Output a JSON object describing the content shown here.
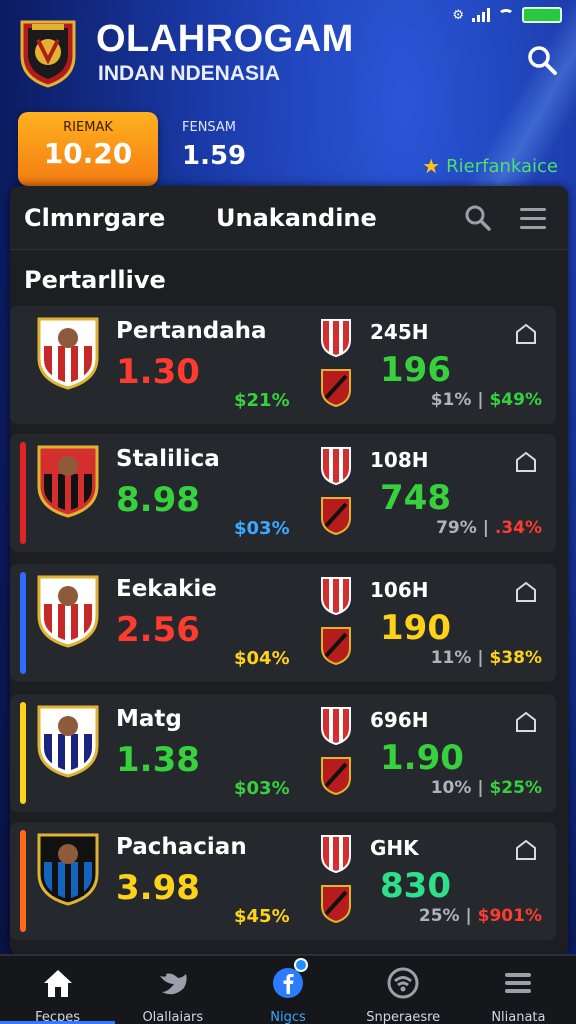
{
  "app": {
    "title": "OLAHROGAM",
    "subtitle": "INDAN NDENASIA"
  },
  "stats": {
    "primary": {
      "label": "RIEMAK",
      "value": "10.20"
    },
    "secondary": {
      "label": "FENSAM",
      "value": "1.59"
    },
    "featured_label": "Rierfankaice"
  },
  "tabs": [
    {
      "label": "Clmnrgare"
    },
    {
      "label": "Unakandine"
    }
  ],
  "section_title": "Pertarllive",
  "matches": [
    {
      "name": "Pertandaha",
      "odds": "1.30",
      "odds_color": "#ff3b30",
      "pct": "$21%",
      "pct_color": "#36d13c",
      "stripe": "#25282d",
      "volume": "245H",
      "odds2": "196",
      "odds2_color": "#36d13c",
      "pct2_a": "$1%",
      "pct2_b": "$49%",
      "pct2_b_color": "#36d13c"
    },
    {
      "name": "Stalilica",
      "odds": "8.98",
      "odds_color": "#36d13c",
      "pct": "$03%",
      "pct_color": "#3aa9ff",
      "stripe": "#e02424",
      "volume": "108H",
      "odds2": "748",
      "odds2_color": "#36d13c",
      "pct2_a": "79%",
      "pct2_b": ".34%",
      "pct2_b_color": "#ff3b30"
    },
    {
      "name": "Eekakie",
      "odds": "2.56",
      "odds_color": "#ff3b30",
      "pct": "$04%",
      "pct_color": "#ffd21a",
      "stripe": "#2f6bff",
      "volume": "106H",
      "odds2": "190",
      "odds2_color": "#ffd21a",
      "pct2_a": "11%",
      "pct2_b": "$38%",
      "pct2_b_color": "#ffd21a"
    },
    {
      "name": "Matg",
      "odds": "1.38",
      "odds_color": "#36d13c",
      "pct": "$03%",
      "pct_color": "#36d13c",
      "stripe": "#ffd21a",
      "volume": "696H",
      "odds2": "1.90",
      "odds2_color": "#36d13c",
      "pct2_a": "10%",
      "pct2_b": "$25%",
      "pct2_b_color": "#36d13c"
    },
    {
      "name": "Pachacian",
      "odds": "3.98",
      "odds_color": "#ffd21a",
      "pct": "$45%",
      "pct_color": "#ffd21a",
      "stripe": "#ff6a1a",
      "volume": " GHK",
      "odds2": "830",
      "odds2_color": "#2ee08a",
      "pct2_a": "25%",
      "pct2_b": "$901%",
      "pct2_b_color": "#ff3b30"
    }
  ],
  "nav": [
    {
      "label": "Fecpes",
      "icon": "home-icon"
    },
    {
      "label": "Olallaiars",
      "icon": "bird-icon"
    },
    {
      "label": "Nigcs",
      "icon": "facebook-icon"
    },
    {
      "label": "Snperaesre",
      "icon": "signal-icon"
    },
    {
      "label": "Nlianata",
      "icon": "menu-icon"
    }
  ]
}
